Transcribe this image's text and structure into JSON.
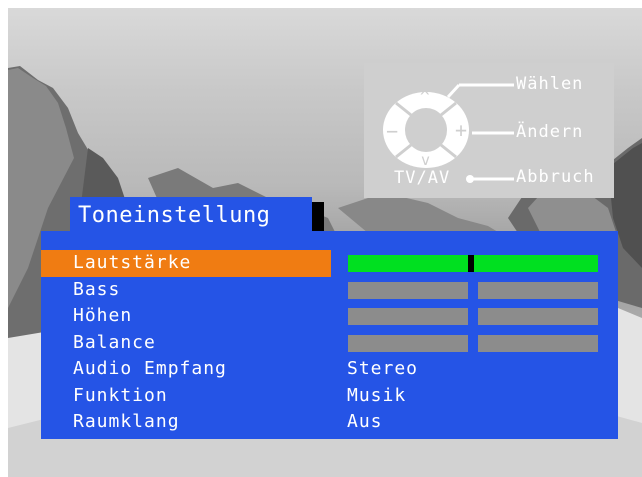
{
  "screen": {
    "title": "Toneinstellung"
  },
  "remote_hint": {
    "up_symbol": "^",
    "down_symbol": "v",
    "minus_symbol": "−",
    "plus_symbol": "+",
    "tvav_label": "TV/AV",
    "select_label": "Wählen",
    "change_label": "Ändern",
    "cancel_label": "Abbruch",
    "icons": [
      "remote-dpad-icon",
      "tvav-button-icon"
    ]
  },
  "menu": {
    "items": [
      {
        "label": "Lautstärke",
        "kind": "bar",
        "selected": true,
        "level": 0.48
      },
      {
        "label": "Bass",
        "kind": "bar",
        "selected": false,
        "level": 0.5
      },
      {
        "label": "Höhen",
        "kind": "bar",
        "selected": false,
        "level": 0.5
      },
      {
        "label": "Balance",
        "kind": "bar",
        "selected": false,
        "level": 0.5
      },
      {
        "label": "Audio Empfang",
        "kind": "value",
        "selected": false,
        "value": "Stereo"
      },
      {
        "label": "Funktion",
        "kind": "value",
        "selected": false,
        "value": "Musik"
      },
      {
        "label": "Raumklang",
        "kind": "value",
        "selected": false,
        "value": "Aus"
      }
    ]
  },
  "colors": {
    "menu_background": "#2554e6",
    "selected_row": "#f07c12",
    "volume_bar": "#00e020",
    "inactive_bar": "#8c8c8c",
    "hint_panel": "#cfcfcf",
    "text": "#ffffff"
  }
}
